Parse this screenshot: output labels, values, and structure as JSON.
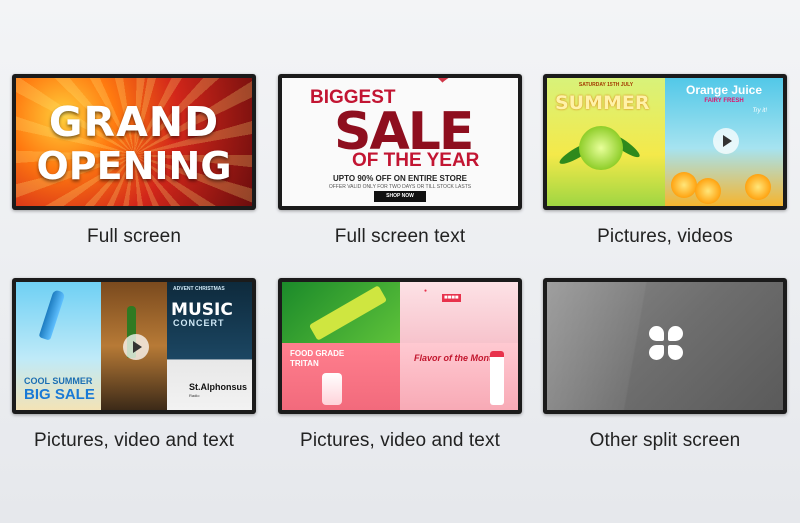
{
  "tiles": [
    {
      "caption": "Full screen",
      "screen_text": [
        "GRAND",
        "OPENING"
      ]
    },
    {
      "caption": "Full screen text",
      "screen_text": [
        "BIGGEST",
        "SALE",
        "OF THE YEAR",
        "UPTO 90% OFF ON ENTIRE STORE",
        "OFFER VALID ONLY FOR TWO DAYS OR TILL STOCK LASTS",
        "SHOP NOW"
      ]
    },
    {
      "caption": "Pictures, videos",
      "screen_text": [
        "SATURDAY 15TH JULY",
        "SUMMER",
        "Orange Juice",
        "FAIRY FRESH",
        "Try it!"
      ]
    },
    {
      "caption": "Pictures, video and text",
      "screen_text": [
        "COOL SUMMER",
        "BIG SALE",
        "ADVENT CHRISTMAS",
        "MUSIC",
        "CONCERT",
        "St.Alphonsus",
        "Radio"
      ]
    },
    {
      "caption": "Pictures, video and text",
      "screen_text": [
        "FOOD GRADE",
        "TRITAN",
        "Flavor of the Month",
        "Strawberry"
      ]
    },
    {
      "caption": "Other split screen",
      "icon": "four-petal-split-icon"
    }
  ],
  "colors": {
    "split_screen": "#6e6e6e",
    "sale_red": "#8e0e1e"
  }
}
